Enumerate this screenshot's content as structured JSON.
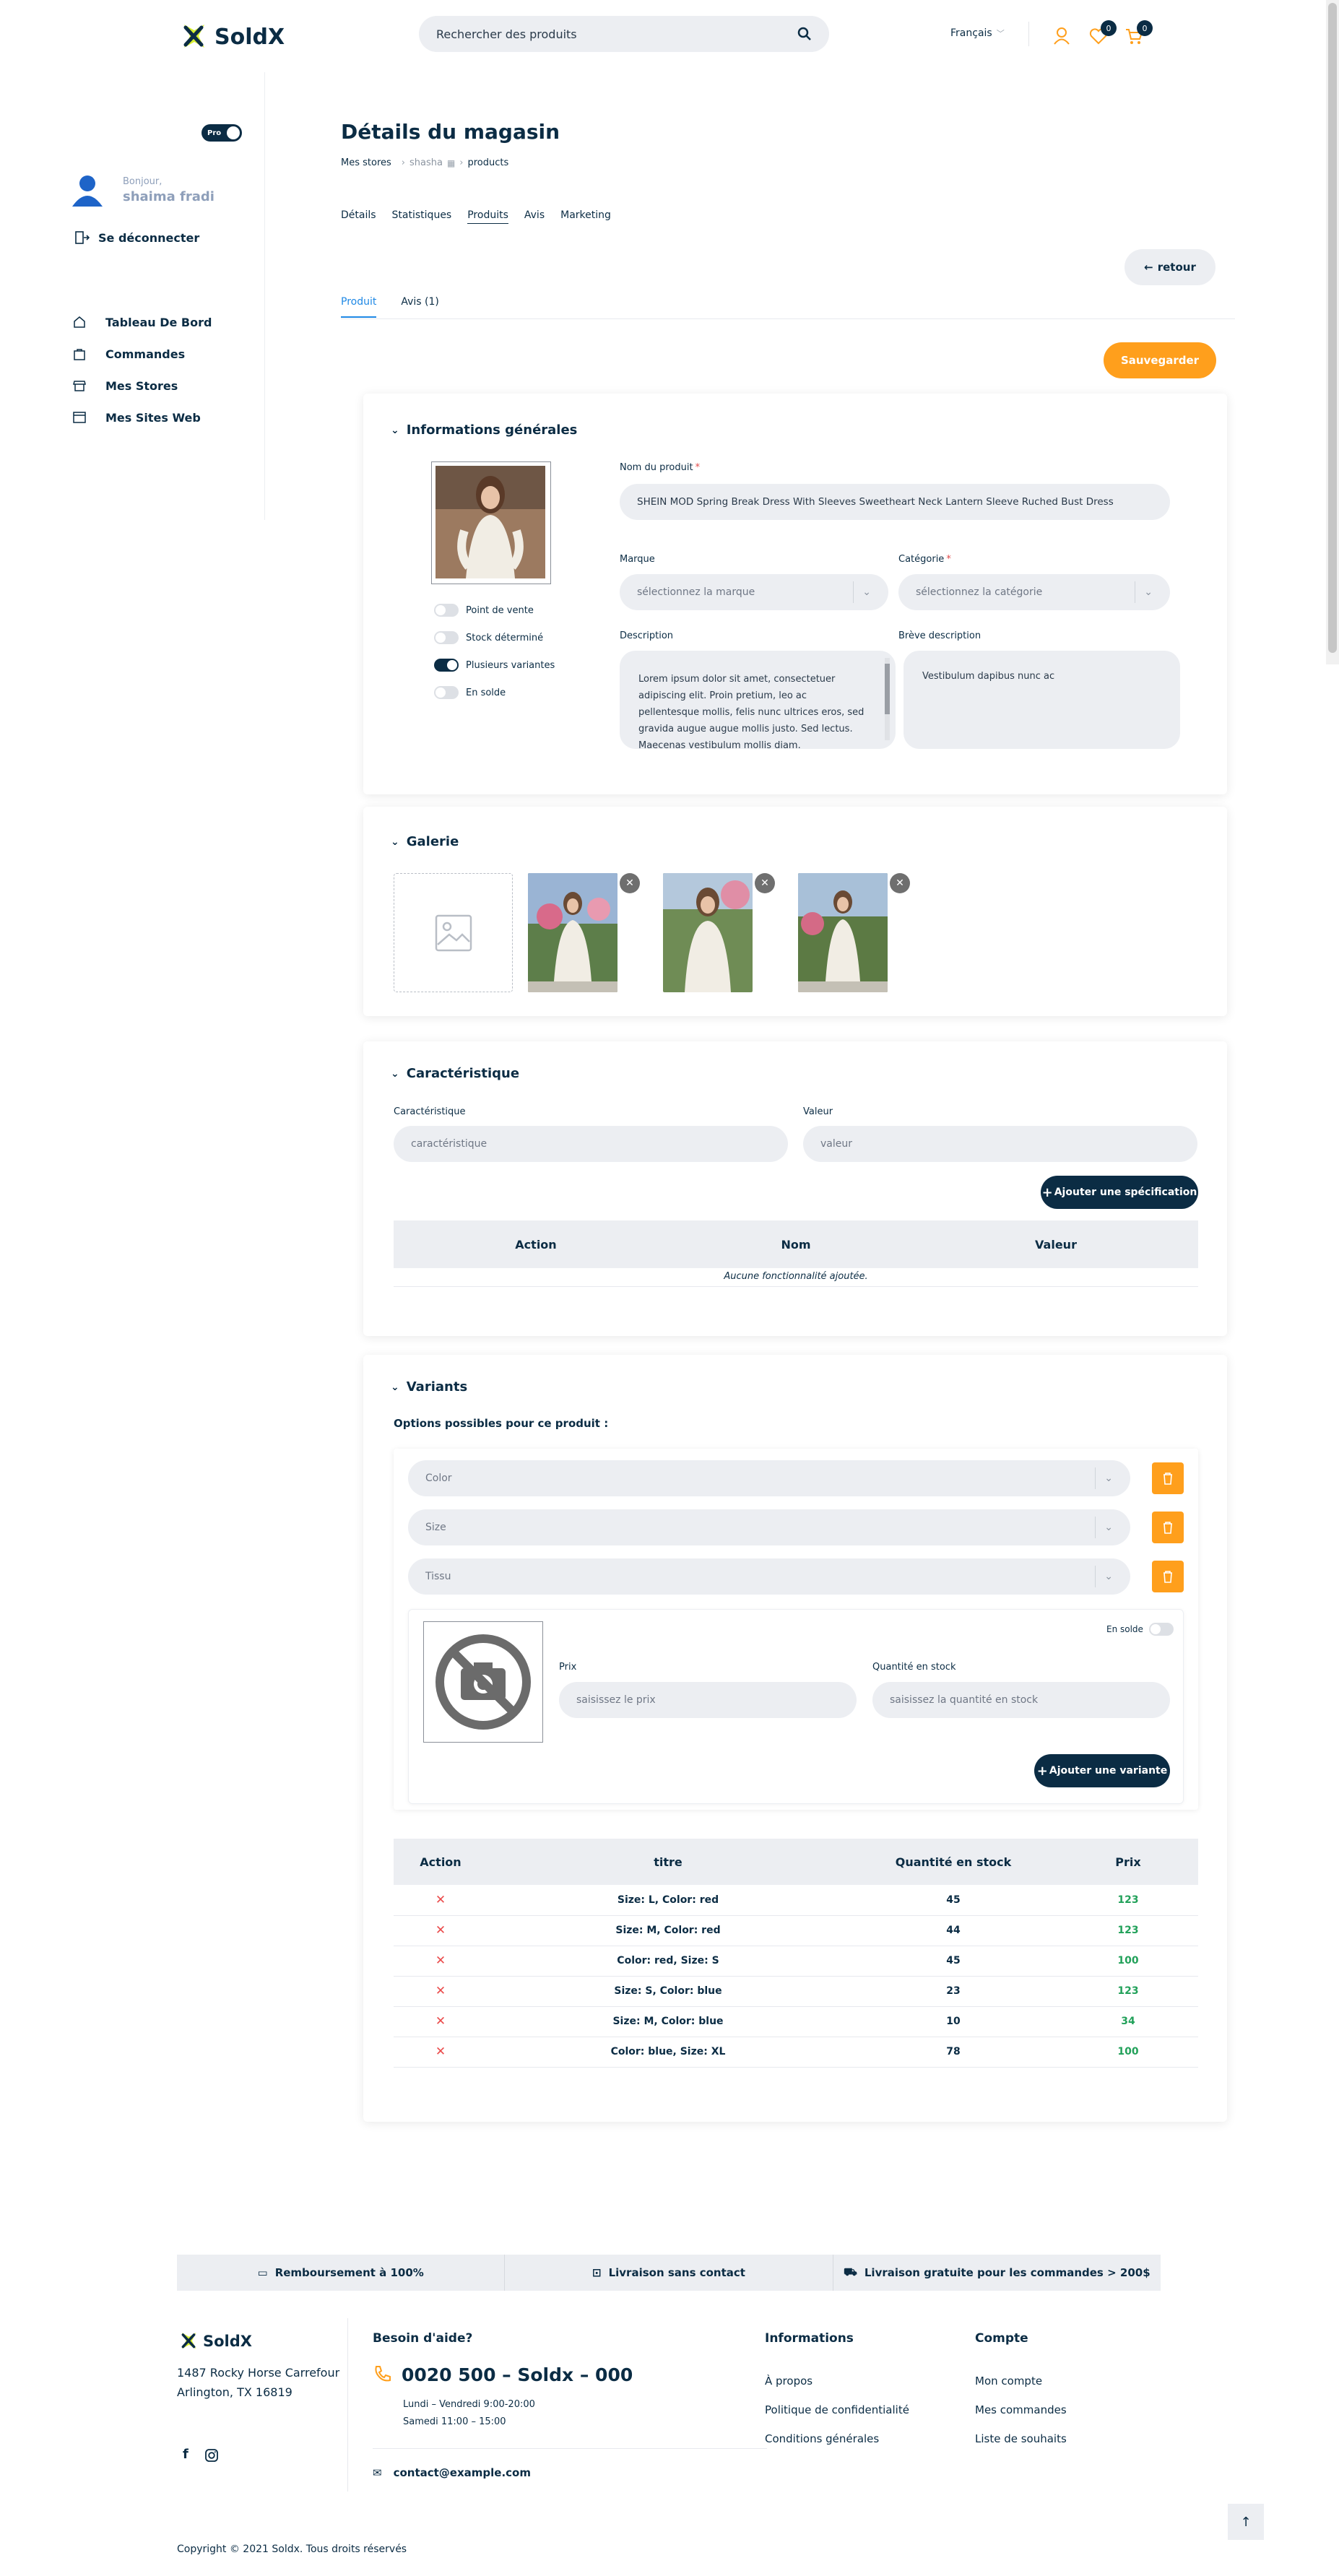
{
  "header": {
    "brand": "SoldX",
    "search_placeholder": "Rechercher des produits",
    "language": "Français",
    "wishlist_count": "0",
    "cart_count": "0"
  },
  "sidebar": {
    "pro_label": "Pro",
    "greeting": "Bonjour,",
    "user_name": "shaima fradi",
    "logout": "Se déconnecter",
    "items": [
      {
        "label": "Tableau De Bord",
        "icon": "home-icon"
      },
      {
        "label": "Commandes",
        "icon": "bag-icon"
      },
      {
        "label": "Mes Stores",
        "icon": "store-icon"
      },
      {
        "label": "Mes Sites Web",
        "icon": "browser-icon"
      }
    ]
  },
  "page": {
    "title": "Détails du magasin",
    "breadcrumb": [
      "Mes stores",
      "shasha",
      "products"
    ],
    "tabs": [
      "Détails",
      "Statistiques",
      "Produits",
      "Avis",
      "Marketing"
    ],
    "back_button": "retour",
    "subtabs": [
      "Produit",
      "Avis (1)"
    ],
    "save_button": "Sauvegarder"
  },
  "general": {
    "title": "Informations générales",
    "toggles": [
      {
        "label": "Point de vente",
        "on": false
      },
      {
        "label": "Stock déterminé",
        "on": false
      },
      {
        "label": "Plusieurs variantes",
        "on": true
      },
      {
        "label": "En solde",
        "on": false
      }
    ],
    "name_label": "Nom du produit",
    "name_value": "SHEIN MOD Spring Break Dress With Sleeves Sweetheart Neck Lantern Sleeve Ruched Bust Dress",
    "brand_label": "Marque",
    "brand_placeholder": "sélectionnez la marque",
    "category_label": "Catégorie",
    "category_placeholder": "sélectionnez la catégorie",
    "description_label": "Description",
    "description_value": "Lorem ipsum dolor sit amet, consectetuer adipiscing elit. Proin pretium, leo ac pellentesque mollis, felis nunc ultrices eros, sed gravida augue augue mollis justo. Sed lectus. Maecenas vestibulum mollis diam.",
    "short_description_label": "Brève description",
    "short_description_value": "Vestibulum dapibus nunc ac"
  },
  "gallery": {
    "title": "Galerie"
  },
  "features": {
    "title": "Caractéristique",
    "feature_label": "Caractéristique",
    "feature_placeholder": "caractéristique",
    "value_label": "Valeur",
    "value_placeholder": "valeur",
    "add_button": "Ajouter une spécification",
    "columns": [
      "Action",
      "Nom",
      "Valeur"
    ],
    "empty": "Aucune fonctionnalité ajoutée."
  },
  "variants": {
    "title": "Variants",
    "options_heading": "Options possibles pour ce produit :",
    "options": [
      "Color",
      "Size",
      "Tissu"
    ],
    "on_sale_label": "En solde",
    "price_label": "Prix",
    "price_placeholder": "saisissez le prix",
    "stock_label": "Quantité en stock",
    "stock_placeholder": "saisissez la quantité en stock",
    "add_button": "Ajouter une variante",
    "columns": [
      "Action",
      "titre",
      "Quantité en stock",
      "Prix"
    ],
    "rows": [
      {
        "title": "Size: L, Color: red",
        "qty": "45",
        "price": "123"
      },
      {
        "title": "Size: M, Color: red",
        "qty": "44",
        "price": "123"
      },
      {
        "title": "Color: red, Size: S",
        "qty": "45",
        "price": "100"
      },
      {
        "title": "Size: S, Color: blue",
        "qty": "23",
        "price": "123"
      },
      {
        "title": "Size: M, Color: blue",
        "qty": "10",
        "price": "34"
      },
      {
        "title": "Color: blue, Size: XL",
        "qty": "78",
        "price": "100"
      }
    ]
  },
  "features_bar": [
    "Remboursement à 100%",
    "Livraison sans contact",
    "Livraison gratuite pour les commandes > 200$"
  ],
  "footer": {
    "brand": "SoldX",
    "address_line1": "1487 Rocky Horse Carrefour",
    "address_line2": "Arlington, TX 16819",
    "help_title": "Besoin d'aide?",
    "phone": "0020 500 – Soldx – 000",
    "hours_weekday": "Lundi – Vendredi 9:00-20:00",
    "hours_saturday": "Samedi 11:00 – 15:00",
    "email": "contact@example.com",
    "info_title": "Informations",
    "info_links": [
      "À propos",
      "Politique de confidentialité",
      "Conditions générales"
    ],
    "account_title": "Compte",
    "account_links": [
      "Mon compte",
      "Mes commandes",
      "Liste de souhaits"
    ],
    "copyright": "Copyright © 2021 Soldx. Tous droits réservés"
  },
  "colors": {
    "navy": "#0b2c44",
    "orange": "#ff9f1c",
    "green": "#22a15a",
    "blue": "#1e88e5",
    "red": "#ea4b4b"
  }
}
